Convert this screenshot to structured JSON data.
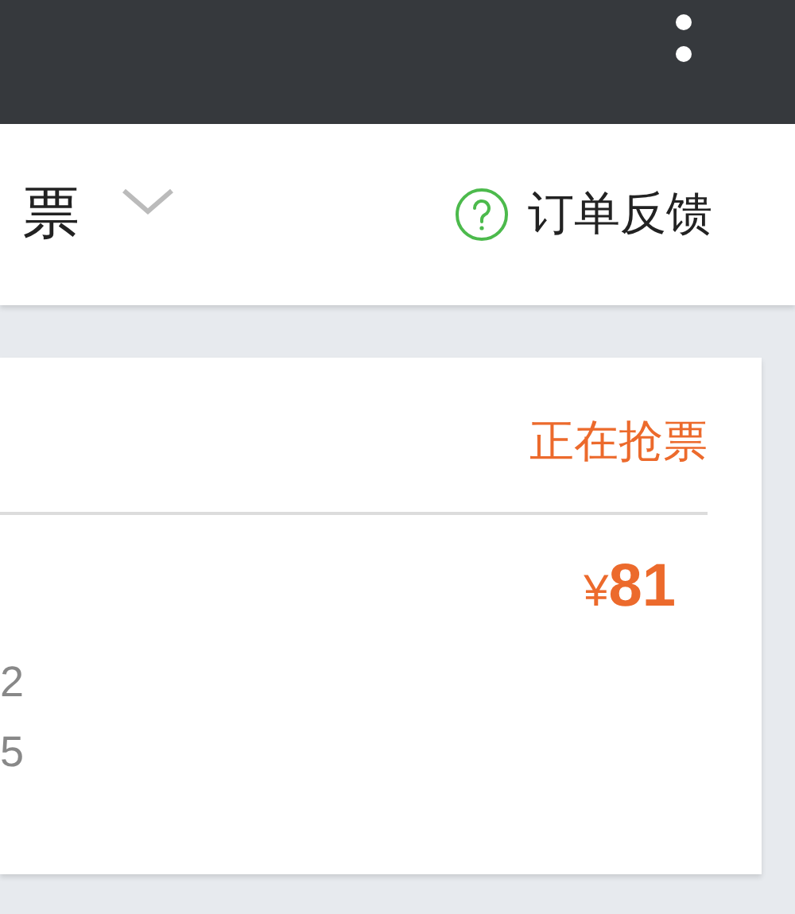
{
  "header": {
    "title": "票",
    "feedback": "订单反馈"
  },
  "order": {
    "status": "正在抢票",
    "price_symbol": "¥",
    "price": "81",
    "lines": [
      "2",
      "5"
    ]
  }
}
